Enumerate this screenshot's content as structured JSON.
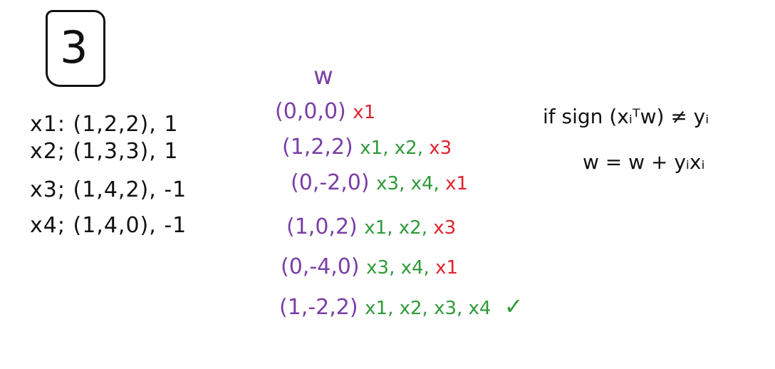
{
  "problem_number": "3",
  "given_points": [
    {
      "label": "x1:",
      "vector": "(1,2,2)",
      "target": ", 1"
    },
    {
      "label": "x2;",
      "vector": "(1,3,3)",
      "target": ", 1"
    },
    {
      "label": "x3;",
      "vector": "(1,4,2)",
      "target": ", -1"
    },
    {
      "label": "x4;",
      "vector": "(1,4,0)",
      "target": ", -1"
    }
  ],
  "weight_header": "w",
  "trace": [
    {
      "w": "(0,0,0)",
      "checks": [
        {
          "text": "x1",
          "status": "misclassified"
        }
      ]
    },
    {
      "w": "(1,2,2)",
      "checks": [
        {
          "text": "x1",
          "status": "ok"
        },
        {
          "text": "x2",
          "status": "ok"
        },
        {
          "text": "x3",
          "status": "misclassified"
        }
      ]
    },
    {
      "w": "(0,-2,0)",
      "checks": [
        {
          "text": "x3",
          "status": "ok"
        },
        {
          "text": "x4",
          "status": "ok"
        },
        {
          "text": "x1",
          "status": "misclassified"
        }
      ]
    },
    {
      "w": "(1,0,2)",
      "checks": [
        {
          "text": "x1",
          "status": "ok"
        },
        {
          "text": "x2",
          "status": "ok"
        },
        {
          "text": "x3",
          "status": "misclassified"
        }
      ]
    },
    {
      "w": "(0,-4,0)",
      "checks": [
        {
          "text": "x3",
          "status": "ok"
        },
        {
          "text": "x4",
          "status": "ok"
        },
        {
          "text": "x1",
          "status": "misclassified"
        }
      ]
    },
    {
      "w": "(1,-2,2)",
      "checks": [
        {
          "text": "x1",
          "status": "ok"
        },
        {
          "text": "x2",
          "status": "ok"
        },
        {
          "text": "x3",
          "status": "ok"
        },
        {
          "text": "x4",
          "status": "ok"
        }
      ],
      "done_mark": "✓"
    }
  ],
  "rule": {
    "condition": "if  sign (xᵢᵀw) ≠ yᵢ",
    "update": "w = w + yᵢxᵢ"
  },
  "colors": {
    "ink_black": "#111111",
    "weights_purple": "#7a3fa6",
    "ok_green": "#2f9a3a",
    "misclassified_red": "#e0232d"
  }
}
